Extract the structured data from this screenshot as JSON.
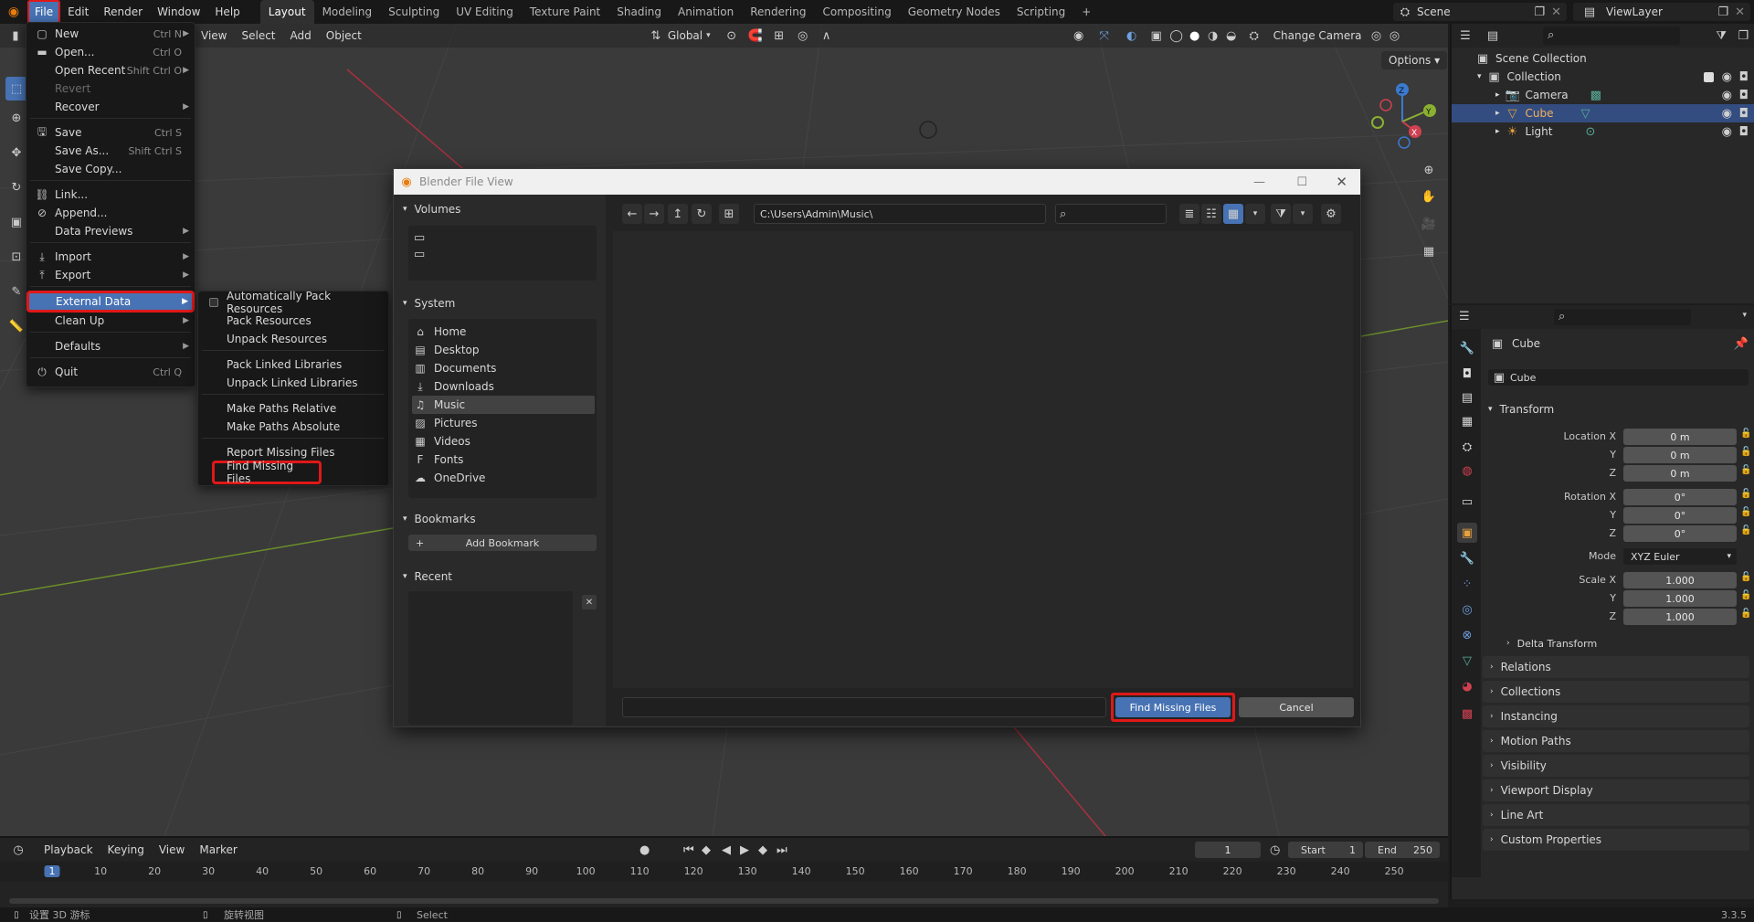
{
  "topbar": {
    "menus": [
      "File",
      "Edit",
      "Render",
      "Window",
      "Help"
    ],
    "workspaces": [
      "Layout",
      "Modeling",
      "Sculpting",
      "UV Editing",
      "Texture Paint",
      "Shading",
      "Animation",
      "Rendering",
      "Compositing",
      "Geometry Nodes",
      "Scripting"
    ],
    "add_tab": "+",
    "scene": "Scene",
    "view_layer": "ViewLayer"
  },
  "viewport": {
    "menus": [
      "View",
      "Select",
      "Add",
      "Object"
    ],
    "orientation": "Global",
    "change_camera": "Change Camera",
    "options": "Options",
    "colors": {
      "bg": "#3a3a3a",
      "grid": "#474747",
      "x_axis": "#b0303a",
      "y_axis": "#6a9a2a"
    }
  },
  "file_menu": {
    "items": [
      {
        "label": "New",
        "shortcut": "Ctrl N",
        "icon": "new-file-icon",
        "arrow": true
      },
      {
        "label": "Open...",
        "shortcut": "Ctrl O",
        "icon": "folder-icon"
      },
      {
        "label": "Open Recent",
        "shortcut": "Shift Ctrl O",
        "arrow": true
      },
      {
        "label": "Revert",
        "disabled": true
      },
      {
        "label": "Recover",
        "arrow": true
      },
      {
        "label": "Save",
        "shortcut": "Ctrl S",
        "icon": "save-icon"
      },
      {
        "label": "Save As...",
        "shortcut": "Shift Ctrl S"
      },
      {
        "label": "Save Copy..."
      },
      {
        "label": "Link...",
        "icon": "link-icon"
      },
      {
        "label": "Append...",
        "icon": "append-icon"
      },
      {
        "label": "Data Previews",
        "arrow": true
      },
      {
        "label": "Import",
        "icon": "import-icon",
        "arrow": true
      },
      {
        "label": "Export",
        "icon": "export-icon",
        "arrow": true
      },
      {
        "label": "External Data",
        "arrow": true,
        "active": true
      },
      {
        "label": "Clean Up",
        "arrow": true
      },
      {
        "label": "Defaults",
        "arrow": true
      },
      {
        "label": "Quit",
        "shortcut": "Ctrl Q",
        "icon": "quit-icon"
      }
    ]
  },
  "external_menu": {
    "items": [
      "Automatically Pack Resources",
      "Pack Resources",
      "Unpack Resources",
      "Pack Linked Libraries",
      "Unpack Linked Libraries",
      "Make Paths Relative",
      "Make Paths Absolute",
      "Report Missing Files",
      "Find Missing Files"
    ]
  },
  "dialog": {
    "title": "Blender File View",
    "path": "C:\\Users\\Admin\\Music\\",
    "search_placeholder": "",
    "volumes_title": "Volumes",
    "system_title": "System",
    "system_items": [
      "Home",
      "Desktop",
      "Documents",
      "Downloads",
      "Music",
      "Pictures",
      "Videos",
      "Fonts",
      "OneDrive"
    ],
    "bookmarks_title": "Bookmarks",
    "add_bookmark": "Add Bookmark",
    "recent_title": "Recent",
    "confirm": "Find Missing Files",
    "cancel": "Cancel"
  },
  "outliner": {
    "scene_collection": "Scene Collection",
    "collection": "Collection",
    "objects": [
      "Camera",
      "Cube",
      "Light"
    ]
  },
  "properties": {
    "object_name": "Cube",
    "data_name": "Cube",
    "transform_title": "Transform",
    "location_label": "Location X",
    "rotation_label": "Rotation X",
    "scale_label": "Scale X",
    "y": "Y",
    "z": "Z",
    "location": [
      "0 m",
      "0 m",
      "0 m"
    ],
    "rotation": [
      "0°",
      "0°",
      "0°"
    ],
    "mode_label": "Mode",
    "mode_value": "XYZ Euler",
    "scale": [
      "1.000",
      "1.000",
      "1.000"
    ],
    "delta": "Delta Transform",
    "sections": [
      "Relations",
      "Collections",
      "Instancing",
      "Motion Paths",
      "Visibility",
      "Viewport Display",
      "Line Art",
      "Custom Properties"
    ]
  },
  "timeline": {
    "menus": [
      "Playback",
      "Keying",
      "View",
      "Marker"
    ],
    "current_frame": "1",
    "start_label": "Start",
    "start": "1",
    "end_label": "End",
    "end": "250",
    "ticks": [
      "1",
      "10",
      "20",
      "30",
      "40",
      "50",
      "60",
      "70",
      "80",
      "90",
      "100",
      "110",
      "120",
      "130",
      "140",
      "150",
      "160",
      "170",
      "180",
      "190",
      "200",
      "210",
      "220",
      "230",
      "240",
      "250"
    ]
  },
  "statusbar": {
    "left": "设置 3D 游标",
    "mid": "旋转视图",
    "right": "Select",
    "version": "3.3.5"
  }
}
